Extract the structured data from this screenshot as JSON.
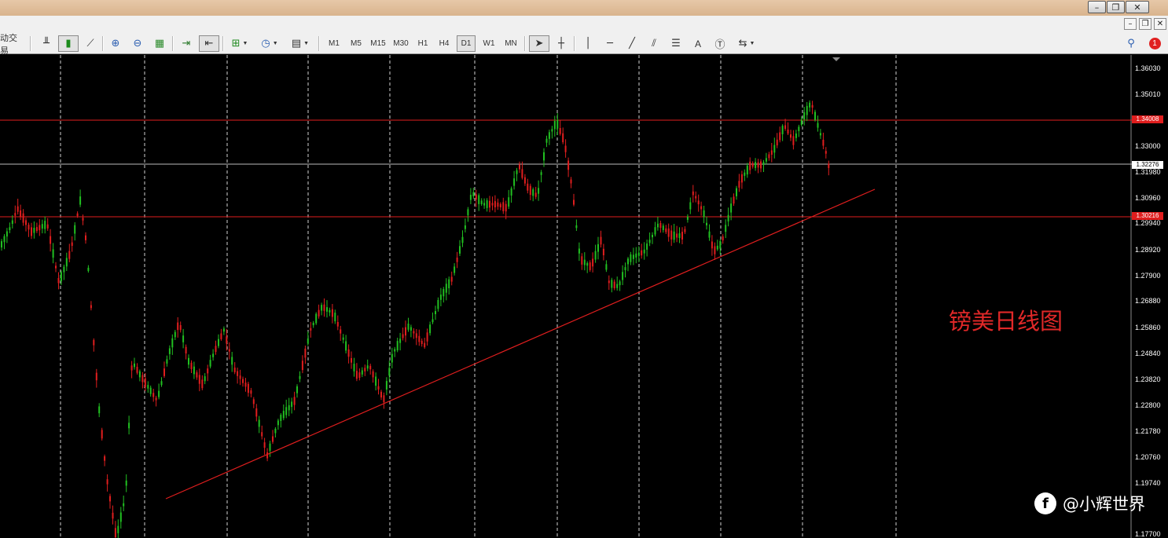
{
  "menu": {
    "partial_label": "动交易"
  },
  "window_controls": {
    "minimize": "–",
    "restore": "❐",
    "close": "✕"
  },
  "mdi_controls": {
    "minimize": "–",
    "restore": "❐",
    "close": "✕"
  },
  "toolbar": {
    "timeframes": [
      "M1",
      "M5",
      "M15",
      "M30",
      "H1",
      "H4",
      "D1",
      "W1",
      "MN"
    ],
    "active_timeframe": "D1",
    "text_tool": "A",
    "notification_count": "1"
  },
  "chart": {
    "price_ticks": [
      "1.36030",
      "1.35010",
      "1.33000",
      "1.31980",
      "1.30960",
      "1.29940",
      "1.28920",
      "1.27900",
      "1.26880",
      "1.25860",
      "1.24840",
      "1.23820",
      "1.22800",
      "1.21780",
      "1.20760",
      "1.19740",
      "1.17700"
    ],
    "price_labels": {
      "resistance": "1.34008",
      "current": "1.32276",
      "support": "1.30216"
    },
    "colors": {
      "bull": "#21c021",
      "bear": "#e01e1e",
      "hline": "#e01e1e",
      "bid": "#bdbdbd",
      "grid": "#d0d0d0"
    }
  },
  "annotation": "镑美日线图",
  "watermark": {
    "text": "@小辉世界"
  }
}
